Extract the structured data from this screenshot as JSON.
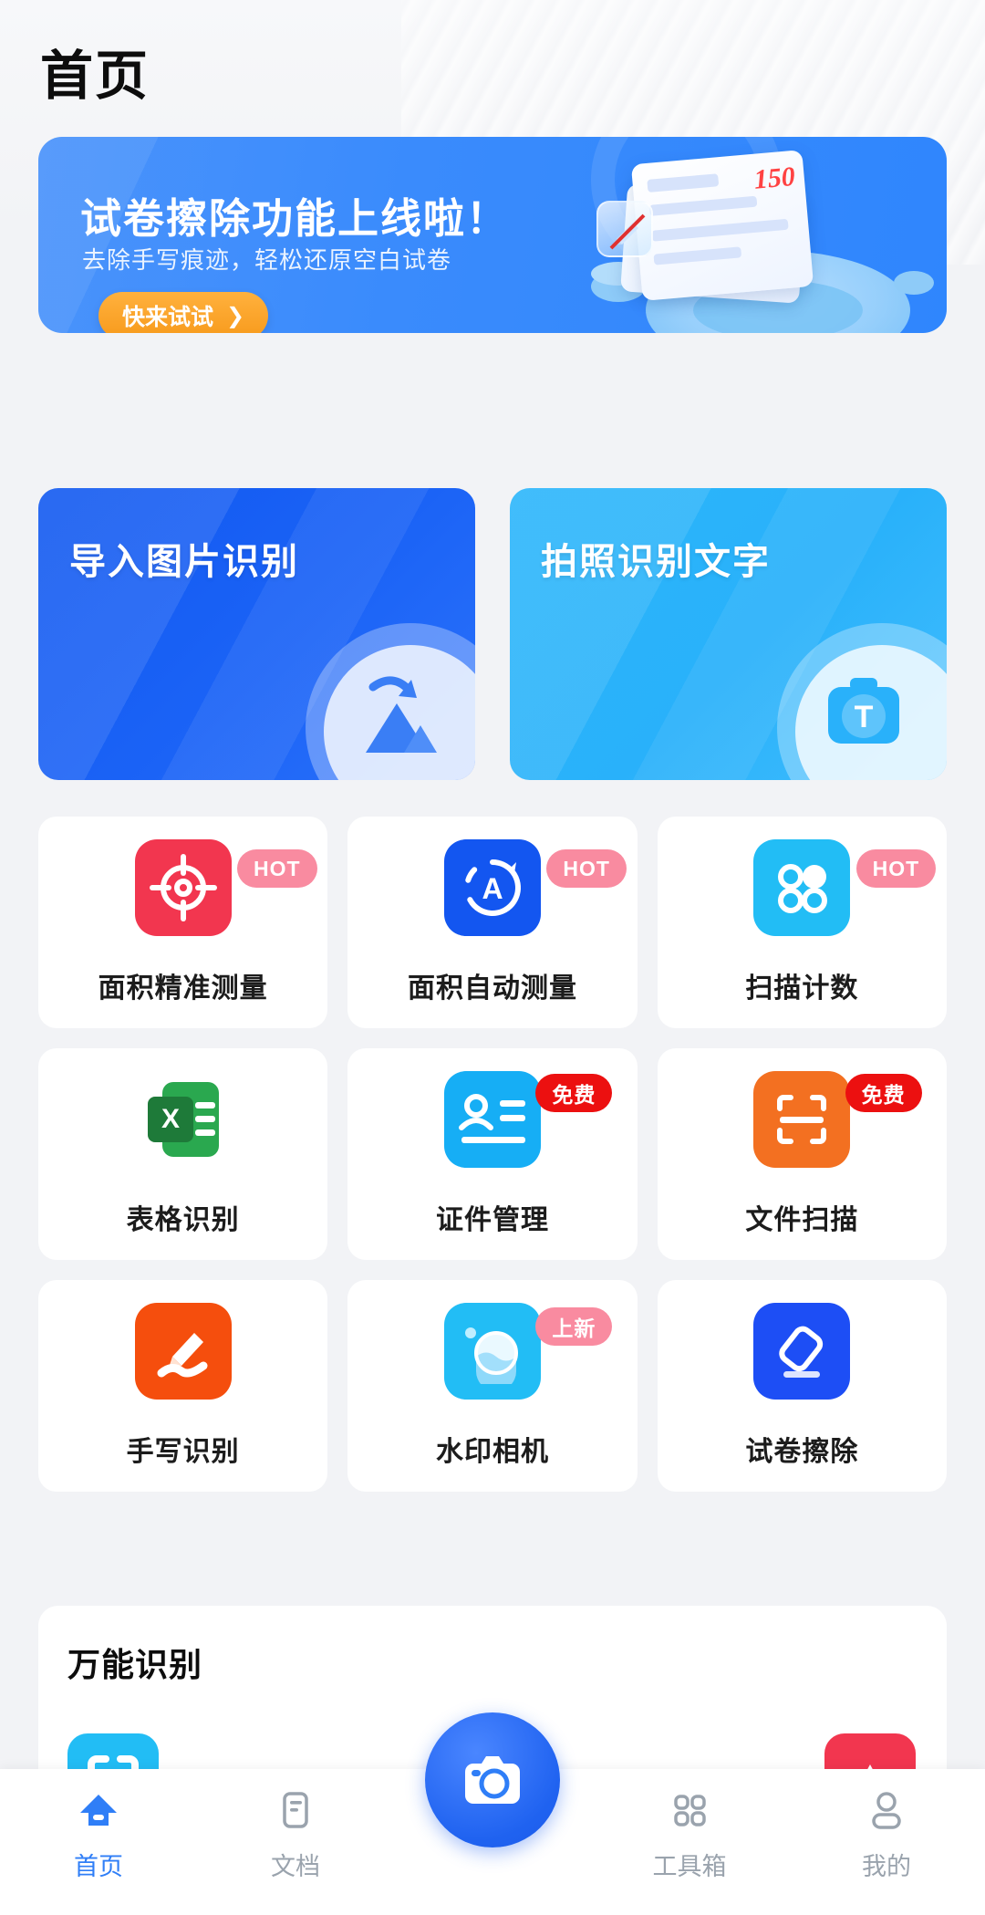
{
  "header": {
    "title": "首页"
  },
  "banner": {
    "title": "试卷擦除功能上线啦！",
    "subtitle": "去除手写痕迹，轻松还原空白试卷",
    "cta_label": "快来试试",
    "cta_chevron": "❯",
    "paper_score": "150",
    "colors": {
      "bg_start": "#4a93fb",
      "bg_end": "#2f86fd",
      "cta": "#f79a1c",
      "score": "#ff4242"
    }
  },
  "big_cards": [
    {
      "label": "导入图片识别",
      "icon": "image-import-icon",
      "color": "#1158f0"
    },
    {
      "label": "拍照识别文字",
      "icon": "camera-text-icon",
      "color": "#2bb6fb"
    }
  ],
  "features": [
    {
      "label": "面积精准测量",
      "badge": "HOT",
      "badge_type": "hot",
      "icon": "crosshair-target-icon",
      "color": "#f2364f"
    },
    {
      "label": "面积自动测量",
      "badge": "HOT",
      "badge_type": "hot",
      "icon": "auto-a-circle-icon",
      "color": "#1356f0"
    },
    {
      "label": "扫描计数",
      "badge": "HOT",
      "badge_type": "hot",
      "icon": "four-dots-count-icon",
      "color": "#22bdf5"
    },
    {
      "label": "表格识别",
      "badge": null,
      "badge_type": null,
      "icon": "excel-sheet-icon",
      "color": "#2aa84f"
    },
    {
      "label": "证件管理",
      "badge": "免费",
      "badge_type": "free",
      "icon": "id-card-icon",
      "color": "#16aef5"
    },
    {
      "label": "文件扫描",
      "badge": "免费",
      "badge_type": "free",
      "icon": "document-scan-icon",
      "color": "#f37021"
    },
    {
      "label": "手写识别",
      "badge": null,
      "badge_type": null,
      "icon": "handwriting-pen-icon",
      "color": "#f54e0d"
    },
    {
      "label": "水印相机",
      "badge": "上新",
      "badge_type": "new",
      "icon": "watermark-camera-icon",
      "color": "#22bdf5"
    },
    {
      "label": "试卷擦除",
      "badge": null,
      "badge_type": null,
      "icon": "eraser-icon",
      "color": "#1d4ef5"
    }
  ],
  "bottom_section": {
    "title": "万能识别"
  },
  "nav": {
    "items": [
      {
        "label": "首页",
        "icon": "home-icon",
        "active": true
      },
      {
        "label": "文档",
        "icon": "doc-icon",
        "active": false
      },
      {
        "label": "工具箱",
        "icon": "grid-icon",
        "active": false
      },
      {
        "label": "我的",
        "icon": "person-icon",
        "active": false
      }
    ],
    "fab_icon": "camera-icon",
    "active_color": "#2f7ef7",
    "inactive_color": "#9aa3ad"
  }
}
